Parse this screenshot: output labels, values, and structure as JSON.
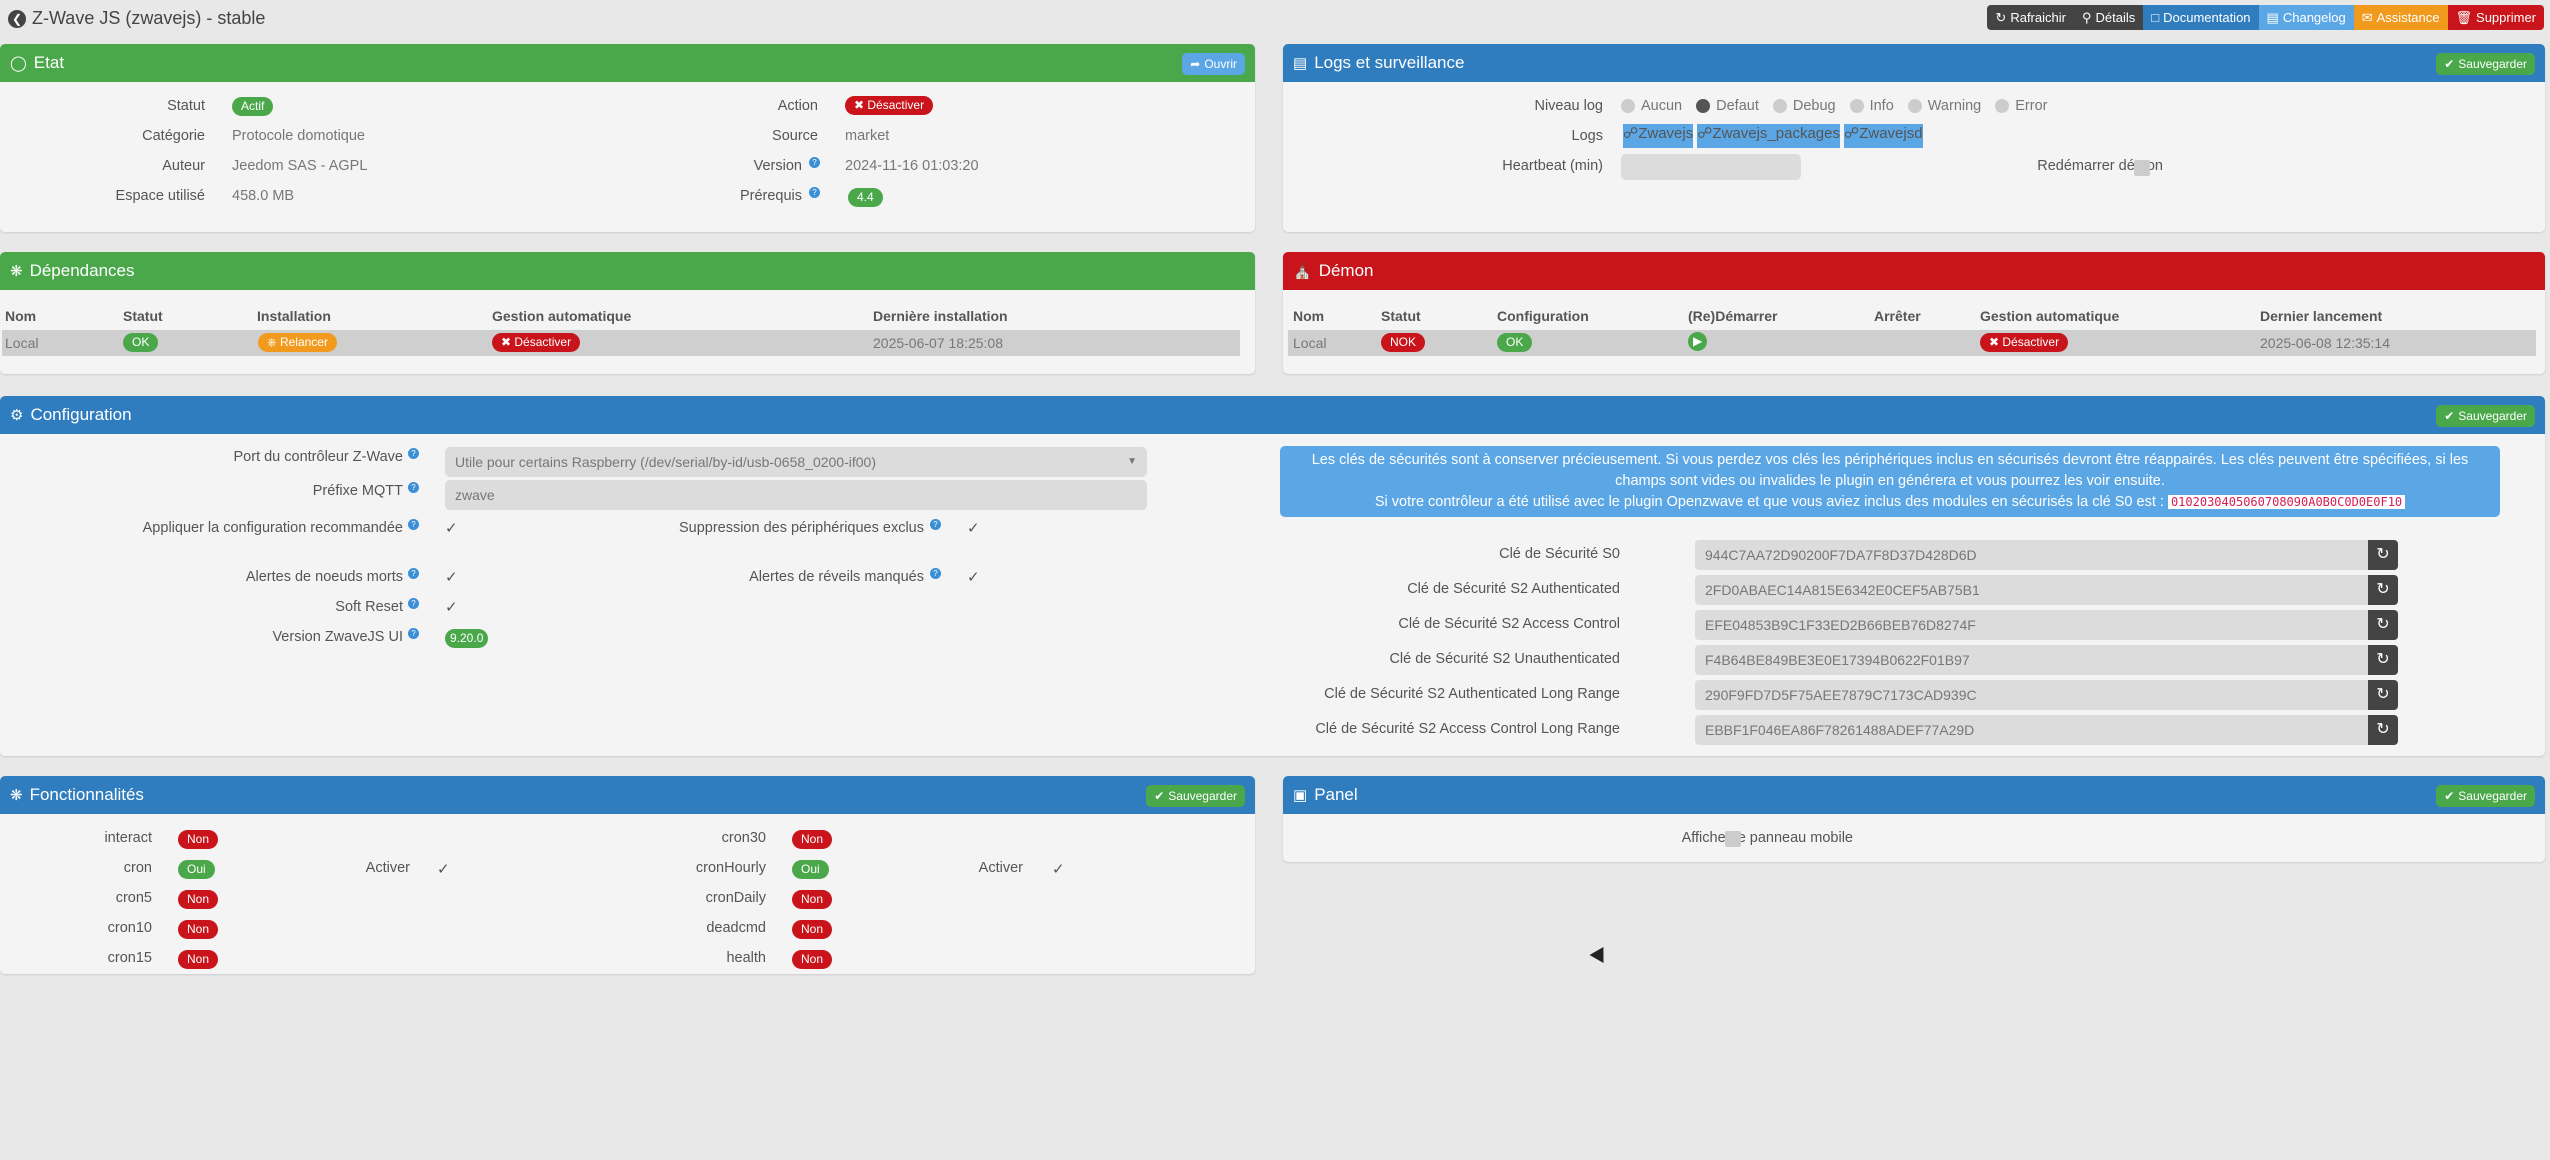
{
  "page": {
    "title": "Z-Wave JS (zwavejs) - stable",
    "actions": [
      {
        "label": "Rafraichir",
        "icon": "refresh-icon",
        "color": "#444444"
      },
      {
        "label": "Détails",
        "icon": "search-icon",
        "color": "#444444"
      },
      {
        "label": "Documentation",
        "icon": "book-icon",
        "color": "#2f7dbf"
      },
      {
        "label": "Changelog",
        "icon": "file-icon",
        "color": "#5ba7e6"
      },
      {
        "label": "Assistance",
        "icon": "help-icon",
        "color": "#f29a1e"
      },
      {
        "label": "Supprimer",
        "icon": "trash-icon",
        "color": "#c8141a"
      }
    ]
  },
  "etat": {
    "title": "Etat",
    "open_button": "Ouvrir",
    "statut_label": "Statut",
    "statut_value": "Actif",
    "categorie_label": "Catégorie",
    "categorie_value": "Protocole domotique",
    "auteur_label": "Auteur",
    "auteur_value": "Jeedom SAS - AGPL",
    "espace_label": "Espace utilisé",
    "espace_value": "458.0 MB",
    "action_label": "Action",
    "action_value": "Désactiver",
    "source_label": "Source",
    "source_value": "market",
    "version_label": "Version",
    "version_value": "2024-11-16 01:03:20",
    "prerequis_label": "Prérequis",
    "prerequis_value": "4.4"
  },
  "logs": {
    "title": "Logs et surveillance",
    "save_button": "Sauvegarder",
    "niveau_label": "Niveau log",
    "levels": [
      "Aucun",
      "Defaut",
      "Debug",
      "Info",
      "Warning",
      "Error"
    ],
    "selected_level": "Defaut",
    "logs_label": "Logs",
    "log_buttons": [
      "Zwavejs",
      "Zwavejs_packages",
      "Zwavejsd"
    ],
    "heartbeat_label": "Heartbeat (min)",
    "heartbeat_value": "",
    "restart_label": "Redémarrer démon"
  },
  "dependances": {
    "title": "Dépendances",
    "headers": [
      "Nom",
      "Statut",
      "Installation",
      "Gestion automatique",
      "Dernière installation"
    ],
    "row": {
      "nom": "Local",
      "statut": "OK",
      "installation": "Relancer",
      "gestion": "Désactiver",
      "derniere": "2025-06-07 18:25:08"
    }
  },
  "demon": {
    "title": "Démon",
    "headers": [
      "Nom",
      "Statut",
      "Configuration",
      "(Re)Démarrer",
      "Arrêter",
      "Gestion automatique",
      "Dernier lancement"
    ],
    "row": {
      "nom": "Local",
      "statut": "NOK",
      "configuration": "OK",
      "gestion": "Désactiver",
      "dernier": "2025-06-08 12:35:14"
    }
  },
  "configuration": {
    "title": "Configuration",
    "save_button": "Sauvegarder",
    "port_label": "Port du contrôleur Z-Wave",
    "port_value": "Utile pour certains Raspberry (/dev/serial/by-id/usb-0658_0200-if00)",
    "mqtt_label": "Préfixe MQTT",
    "mqtt_value": "zwave",
    "recommended_label": "Appliquer la configuration recommandée",
    "suppression_label": "Suppression des périphériques exclus",
    "dead_label": "Alertes de noeuds morts",
    "wakeup_label": "Alertes de réveils manqués",
    "softreset_label": "Soft Reset",
    "ui_version_label": "Version ZwaveJS UI",
    "ui_version_value": "9.20.0",
    "notice_line1": "Les clés de sécurités sont à conserver précieusement. Si vous perdez vos clés les périphériques inclus en sécurisés devront être réappairés. Les clés peuvent être spécifiées, si les champs sont vides ou invalides le plugin en générera et vous pourrez les voir ensuite.",
    "notice_line2": "Si votre contrôleur a été utilisé avec le plugin Openzwave et que vous aviez inclus des modules en sécurisés la clé S0 est :",
    "notice_code": "0102030405060708090A0B0C0D0E0F10",
    "keys": [
      {
        "label": "Clé de Sécurité S0",
        "value": "944C7AA72D90200F7DA7F8D37D428D6D"
      },
      {
        "label": "Clé de Sécurité S2 Authenticated",
        "value": "2FD0ABAEC14A815E6342E0CEF5AB75B1"
      },
      {
        "label": "Clé de Sécurité S2 Access Control",
        "value": "EFE04853B9C1F33ED2B66BEB76D8274F"
      },
      {
        "label": "Clé de Sécurité S2 Unauthenticated",
        "value": "F4B64BE849BE3E0E17394B0622F01B97"
      },
      {
        "label": "Clé de Sécurité S2 Authenticated Long Range",
        "value": "290F9FD7D5F75AEE7879C7173CAD939C"
      },
      {
        "label": "Clé de Sécurité S2 Access Control Long Range",
        "value": "EBBF1F046EA86F78261488ADEF77A29D"
      }
    ]
  },
  "fonctionnalites": {
    "title": "Fonctionnalités",
    "save_button": "Sauvegarder",
    "activer_label": "Activer",
    "left": [
      {
        "name": "interact",
        "value": "Non"
      },
      {
        "name": "cron",
        "value": "Oui"
      },
      {
        "name": "cron5",
        "value": "Non"
      },
      {
        "name": "cron10",
        "value": "Non"
      },
      {
        "name": "cron15",
        "value": "Non"
      }
    ],
    "right": [
      {
        "name": "cron30",
        "value": "Non"
      },
      {
        "name": "cronHourly",
        "value": "Oui"
      },
      {
        "name": "cronDaily",
        "value": "Non"
      },
      {
        "name": "deadcmd",
        "value": "Non"
      },
      {
        "name": "health",
        "value": "Non"
      }
    ]
  },
  "panel": {
    "title": "Panel",
    "save_button": "Sauvegarder",
    "mobile_label": "Afficher le panneau mobile"
  }
}
